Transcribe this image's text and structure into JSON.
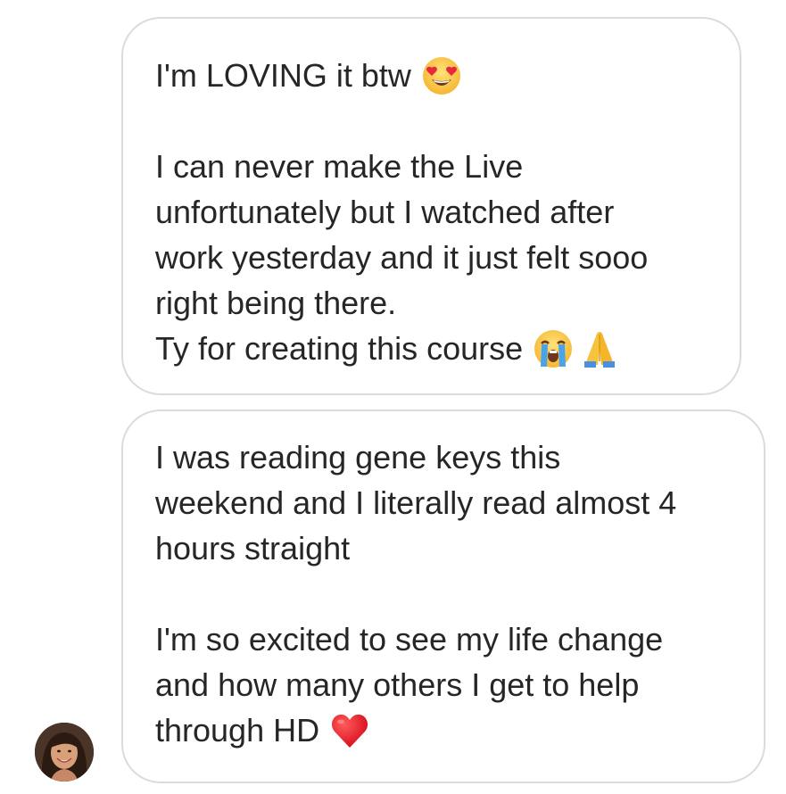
{
  "thread": {
    "messages": [
      {
        "paragraphs": [
          {
            "lines": [
              {
                "text": "I'm LOVING it btw",
                "emoji": [
                  "heart-eyes-face-emoji"
                ]
              }
            ]
          },
          {
            "lines": [
              {
                "text": "I can never make the Live"
              },
              {
                "text": "unfortunately but I watched after"
              },
              {
                "text": "work yesterday and it just felt sooo"
              },
              {
                "text": "right being there."
              },
              {
                "text": "Ty for creating this course",
                "emoji": [
                  "loudly-crying-face-emoji",
                  "folded-hands-emoji"
                ]
              }
            ]
          }
        ]
      },
      {
        "paragraphs": [
          {
            "lines": [
              {
                "text": "I was reading gene keys this"
              },
              {
                "text": "weekend and I literally read almost 4"
              },
              {
                "text": "hours straight"
              }
            ]
          },
          {
            "lines": [
              {
                "text": "I'm so excited to see my life change"
              },
              {
                "text": "and how many others I get to help"
              },
              {
                "text": "through HD",
                "emoji": [
                  "red-heart-emoji"
                ]
              }
            ]
          }
        ]
      }
    ]
  },
  "colors": {
    "text": "#262626",
    "bubble_border": "#dbdbdb",
    "background": "#ffffff"
  }
}
